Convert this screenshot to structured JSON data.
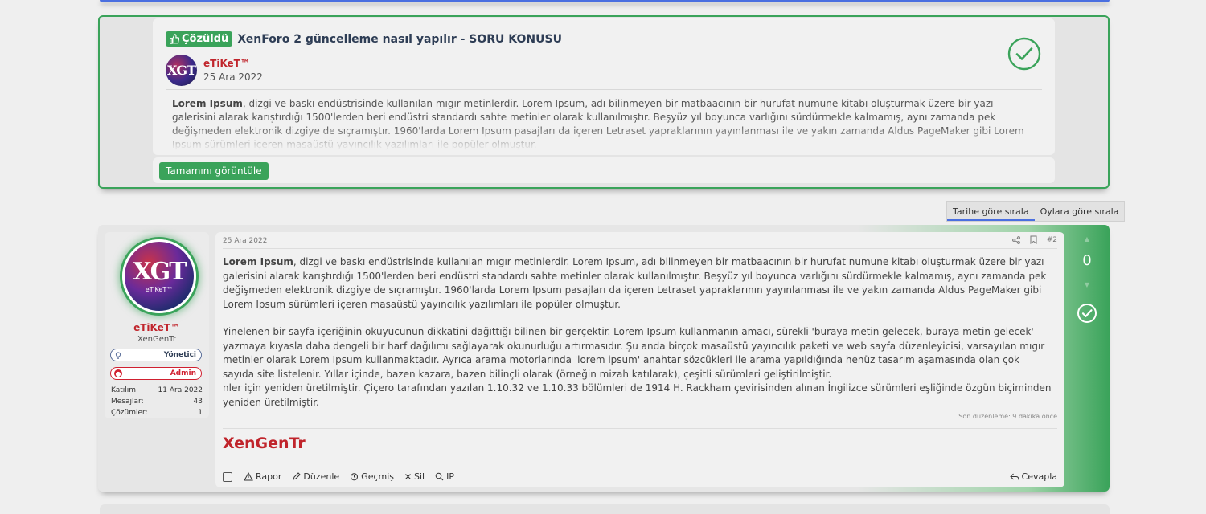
{
  "solved": {
    "badge_label": "Çözüldü",
    "title": "XenForo 2 güncelleme nasıl yapılır - SORU KONUSU",
    "author": "eTiKeT™",
    "date": "25 Ara 2022",
    "text_lead": "Lorem Ipsum",
    "text_rest": ", dizgi ve baskı endüstrisinde kullanılan mıgır metinlerdir. Lorem Ipsum, adı bilinmeyen bir matbaacının bir hurufat numune kitabı oluşturmak üzere bir yazı galerisini alarak karıştırdığı 1500'lerden beri endüstri standardı sahte metinler olarak kullanılmıştır. Beşyüz yıl boyunca varlığını sürdürmekle kalmamış, aynı zamanda pek değişmeden elektronik dizgiye de sıçramıştır. 1960'larda Lorem Ipsum pasajları da içeren Letraset yapraklarının yayınlanması ile ve yakın zamanda Aldus PageMaker gibi Lorem Ipsum sürümleri içeren masaüstü yayıncılık yazılımları ile popüler olmuştur.",
    "button_label": "Tamamını görüntüle",
    "avatar_text": "XGT"
  },
  "sort": {
    "by_date": "Tarihe göre sırala",
    "by_votes": "Oylara göre sırala"
  },
  "post": {
    "date": "25 Ara 2022",
    "number": "#2",
    "user": {
      "name": "eTiKeT™",
      "title": "XenGenTr",
      "avatar_logo": "XGT",
      "avatar_sub": "eTiKeT™",
      "role_mod": "Yönetici",
      "role_admin": "Admin",
      "stats": [
        {
          "label": "Katılım:",
          "value": "11 Ara 2022"
        },
        {
          "label": "Mesajlar:",
          "value": "43"
        },
        {
          "label": "Çözümler:",
          "value": "1"
        }
      ]
    },
    "p1_lead": "Lorem Ipsum",
    "p1_rest": ", dizgi ve baskı endüstrisinde kullanılan mıgır metinlerdir. Lorem Ipsum, adı bilinmeyen bir matbaacının bir hurufat numune kitabı oluşturmak üzere bir yazı galerisini alarak karıştırdığı 1500'lerden beri endüstri standardı sahte metinler olarak kullanılmıştır. Beşyüz yıl boyunca varlığını sürdürmekle kalmamış, aynı zamanda pek değişmeden elektronik dizgiye de sıçramıştır. 1960'larda Lorem Ipsum pasajları da içeren Letraset yapraklarının yayınlanması ile ve yakın zamanda Aldus PageMaker gibi Lorem Ipsum sürümleri içeren masaüstü yayıncılık yazılımları ile popüler olmuştur.",
    "p2": "Yinelenen bir sayfa içeriğinin okuyucunun dikkatini dağıttığı bilinen bir gerçektir. Lorem Ipsum kullanmanın amacı, sürekli 'buraya metin gelecek, buraya metin gelecek' yazmaya kıyasla daha dengeli bir harf dağılımı sağlayarak okunurluğu artırmasıdır. Şu anda birçok masaüstü yayıncılık paketi ve web sayfa düzenleyicisi, varsayılan mıgır metinler olarak Lorem Ipsum kullanmaktadır. Ayrıca arama motorlarında 'lorem ipsum' anahtar sözcükleri ile arama yapıldığında henüz tasarım aşamasında olan çok sayıda site listelenir. Yıllar içinde, bazen kazara, bazen bilinçli olarak (örneğin mizah katılarak), çeşitli sürümleri geliştirilmiştir.",
    "p3": "nler için yeniden üretilmiştir. Çiçero tarafından yazılan 1.10.32 ve 1.10.33 bölümleri de 1914 H. Rackham çevirisinden alınan İngilizce sürümleri eşliğinde özgün biçiminden yeniden üretilmiştir.",
    "edited": "Son düzenleme: 9 dakika önce",
    "signature": "XenGenTr",
    "actions": {
      "report": "Rapor",
      "edit": "Düzenle",
      "history": "Geçmiş",
      "delete": "Sil",
      "ip": "IP",
      "reply": "Cevapla"
    },
    "votes": "0"
  },
  "colors": {
    "accent_green": "#3aa35a",
    "username_red": "#c0242b",
    "link_blue": "#4a6fe0"
  }
}
